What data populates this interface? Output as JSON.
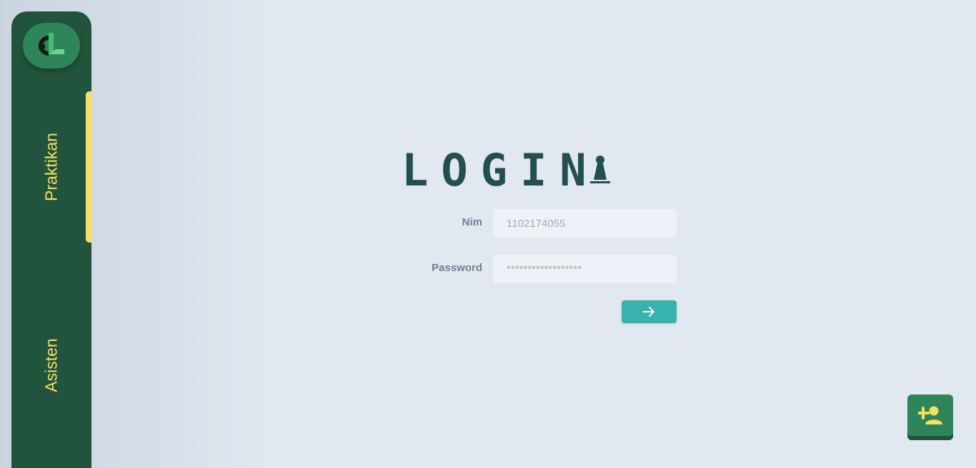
{
  "sidebar": {
    "logo_icon": "app-logo",
    "items": [
      {
        "label": "Praktikan",
        "active": true
      },
      {
        "label": "Asisten",
        "active": false
      }
    ]
  },
  "login": {
    "title": "LOGIN",
    "title_icon": "lock-icon",
    "nim_label": "Nim",
    "nim_placeholder": "1102174055",
    "password_label": "Password",
    "password_placeholder": "******************",
    "submit_icon": "arrow-right-icon"
  },
  "register_button": {
    "icon": "add-user-icon"
  },
  "colors": {
    "sidebar_bg": "#22543d",
    "accent_yellow": "#f6e05e",
    "title": "#234e52",
    "submit_bg": "#38b2ac",
    "logo_bg": "#2f855a"
  }
}
